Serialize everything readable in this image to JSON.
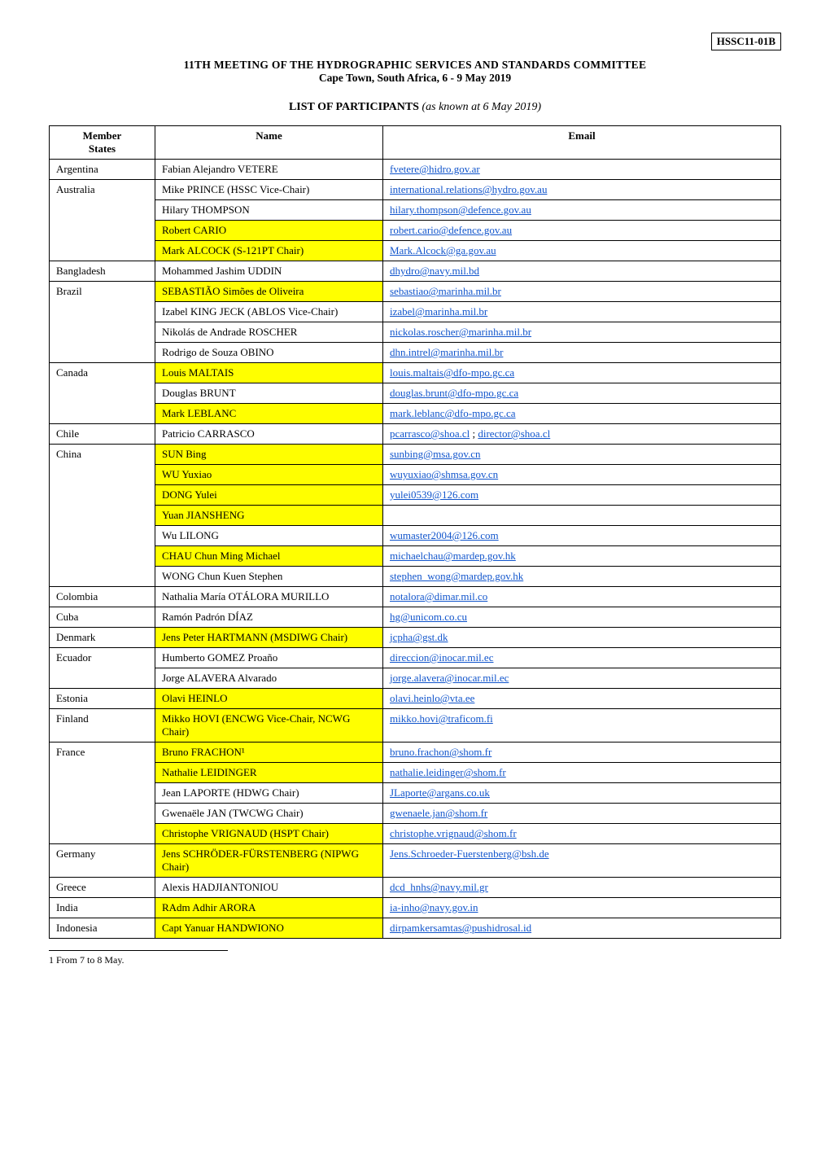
{
  "docId": "HSSC11-01B",
  "header": {
    "meetingTitle": "11th Meeting of the Hydrographic Services and Standards Committee",
    "meetingSubtitle": "Cape Town, South Africa, 6 - 9 May 2019"
  },
  "sectionTitle": "LIST OF PARTICIPANTS",
  "sectionNote": "(as known at 6 May 2019)",
  "tableHeaders": [
    "Member\nStates",
    "Name",
    "Email"
  ],
  "footnote": "1 From 7 to 8 May.",
  "participants": [
    {
      "member": "Argentina",
      "entries": [
        {
          "name": "Fabian Alejandro VETERE",
          "email": "fvetere@hidro.gov.ar",
          "highlight": false
        }
      ]
    },
    {
      "member": "Australia",
      "entries": [
        {
          "name": "Mike PRINCE (HSSC Vice-Chair)",
          "email": "international.relations@hydro.gov.au",
          "highlight": false
        },
        {
          "name": "Hilary THOMPSON",
          "email": "hilary.thompson@defence.gov.au",
          "highlight": false
        },
        {
          "name": "Robert CARIO",
          "email": "robert.cario@defence.gov.au",
          "highlight": true
        },
        {
          "name": "Mark ALCOCK (S-121PT Chair)",
          "email": "Mark.Alcock@ga.gov.au",
          "highlight": true
        }
      ]
    },
    {
      "member": "Bangladesh",
      "entries": [
        {
          "name": "Mohammed Jashim UDDIN",
          "email": "dhydro@navy.mil.bd",
          "highlight": false
        }
      ]
    },
    {
      "member": "Brazil",
      "entries": [
        {
          "name": "SEBASTIÃO Simões de Oliveira",
          "email": "sebastiao@marinha.mil.br",
          "highlight": true
        },
        {
          "name": "Izabel KING JECK (ABLOS Vice-Chair)",
          "email": "izabel@marinha.mil.br",
          "highlight": false
        },
        {
          "name": "Nikolás de Andrade ROSCHER",
          "email": "nickolas.roscher@marinha.mil.br",
          "highlight": false
        },
        {
          "name": "Rodrigo de Souza OBINO",
          "email": "dhn.intrel@marinha.mil.br",
          "highlight": false
        }
      ]
    },
    {
      "member": "Canada",
      "entries": [
        {
          "name": "Louis MALTAIS",
          "email": "louis.maltais@dfo-mpo.gc.ca",
          "highlight": true
        },
        {
          "name": "Douglas BRUNT",
          "email": "douglas.brunt@dfo-mpo.gc.ca",
          "highlight": false
        },
        {
          "name": "Mark LEBLANC",
          "email": "mark.leblanc@dfo-mpo.gc.ca",
          "highlight": true
        }
      ]
    },
    {
      "member": "Chile",
      "entries": [
        {
          "name": "Patricio CARRASCO",
          "email": "pcarrasco@shoa.cl ; director@shoa.cl",
          "highlight": false
        }
      ]
    },
    {
      "member": "China",
      "entries": [
        {
          "name": "SUN Bing",
          "email": "sunbing@msa.gov.cn",
          "highlight": true
        },
        {
          "name": "WU Yuxiao",
          "email": "wuyuxiao@shmsa.gov.cn",
          "highlight": true
        },
        {
          "name": "DONG Yulei",
          "email": "yulei0539@126.com",
          "highlight": true
        },
        {
          "name": "Yuan JIANSHENG",
          "email": "",
          "highlight": true
        },
        {
          "name": "Wu LILONG",
          "email": "wumaster2004@126.com",
          "highlight": false
        },
        {
          "name": "CHAU Chun Ming Michael",
          "email": "michaelchau@mardep.gov.hk",
          "highlight": true
        },
        {
          "name": "WONG Chun Kuen Stephen",
          "email": "stephen_wong@mardep.gov.hk",
          "highlight": false
        }
      ]
    },
    {
      "member": "Colombia",
      "entries": [
        {
          "name": "Nathalia María OTÁLORA MURILLO",
          "email": "notalora@dimar.mil.co",
          "highlight": false
        }
      ]
    },
    {
      "member": "Cuba",
      "entries": [
        {
          "name": "Ramón Padrón DÍAZ",
          "email": "hg@unicom.co.cu",
          "highlight": false
        }
      ]
    },
    {
      "member": "Denmark",
      "entries": [
        {
          "name": "Jens Peter HARTMANN (MSDIWG Chair)",
          "email": "jcpha@gst.dk",
          "highlight": true
        }
      ]
    },
    {
      "member": "Ecuador",
      "entries": [
        {
          "name": "Humberto GOMEZ Proaño",
          "email": "direccion@inocar.mil.ec",
          "highlight": false
        },
        {
          "name": "Jorge ALAVERA Alvarado",
          "email": "jorge.alavera@inocar.mil.ec",
          "highlight": false
        }
      ]
    },
    {
      "member": "Estonia",
      "entries": [
        {
          "name": "Olavi HEINLO",
          "email": "olavi.heinlo@vta.ee",
          "highlight": true
        }
      ]
    },
    {
      "member": "Finland",
      "entries": [
        {
          "name": "Mikko HOVI (ENCWG Vice-Chair, NCWG Chair)",
          "email": "mikko.hovi@traficom.fi",
          "highlight": true
        }
      ]
    },
    {
      "member": "France",
      "entries": [
        {
          "name": "Bruno FRACHON¹",
          "email": "bruno.frachon@shom.fr",
          "highlight": true
        },
        {
          "name": "Nathalie LEIDINGER",
          "email": "nathalie.leidinger@shom.fr",
          "highlight": true
        },
        {
          "name": "Jean LAPORTE (HDWG Chair)",
          "email": "JLaporte@argans.co.uk",
          "highlight": false
        },
        {
          "name": "Gwenaële JAN (TWCWG Chair)",
          "email": "gwenaele.jan@shom.fr",
          "highlight": false
        },
        {
          "name": "Christophe VRIGNAUD (HSPT Chair)",
          "email": "christophe.vrignaud@shom.fr",
          "highlight": true
        }
      ]
    },
    {
      "member": "Germany",
      "entries": [
        {
          "name": "Jens SCHRÖDER-FÜRSTENBERG (NIPWG Chair)",
          "email": "Jens.Schroeder-Fuerstenberg@bsh.de",
          "highlight": true
        }
      ]
    },
    {
      "member": "Greece",
      "entries": [
        {
          "name": "Alexis HADJIANTONIOU",
          "email": "dcd_hnhs@navy.mil.gr",
          "highlight": false
        }
      ]
    },
    {
      "member": "India",
      "entries": [
        {
          "name": "RAdm Adhir ARORA",
          "email": "ia-inho@navy.gov.in",
          "highlight": true
        }
      ]
    },
    {
      "member": "Indonesia",
      "entries": [
        {
          "name": "Capt Yanuar HANDWIONO",
          "email": "dirpamkersamtas@pushidrosal.id",
          "highlight": true
        }
      ]
    }
  ]
}
